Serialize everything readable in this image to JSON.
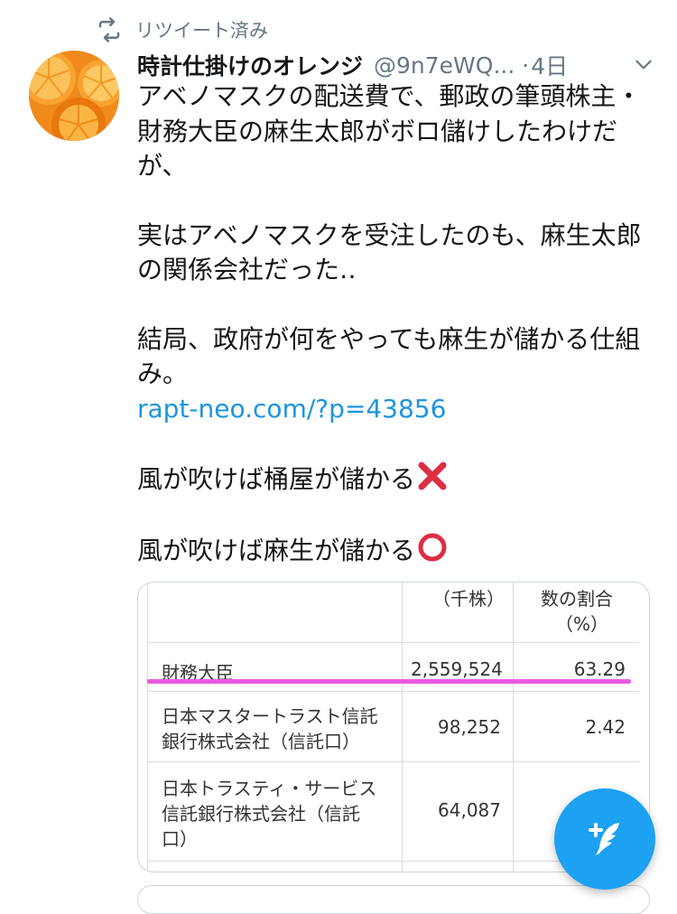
{
  "retweet": {
    "label": "リツイート済み"
  },
  "tweet": {
    "author_name": "時計仕掛けのオレンジ",
    "handle": "@9n7eWQ...",
    "dot": "·",
    "age": "4日",
    "lines": [
      "アベノマスクの配送費で、郵政の筆頭株主・",
      "財務大臣の麻生太郎がボロ儲けしたわけだ",
      "が、",
      "実はアベノマスクを受注したのも、麻生太郎",
      "の関係会社だった‥",
      "結局、政府が何をやっても麻生が儲かる仕組",
      "み。",
      "rapt-neo.com/?p=43856",
      "風が吹けば桶屋が儲かる",
      "風が吹けば麻生が儲かる"
    ]
  },
  "media_table": {
    "headers": [
      "（千株）",
      "数の割合",
      "（%）"
    ],
    "rows": [
      {
        "name_lines": [
          "財務大臣"
        ],
        "shares": "2,559,524",
        "pct": "63.29"
      },
      {
        "name_lines": [
          "日本マスタートラスト信託",
          "銀行株式会社（信託口）"
        ],
        "shares": "98,252",
        "pct": "2.42"
      },
      {
        "name_lines": [
          "日本トラスティ・サービス",
          "信託銀行株式会社（信託",
          "口）"
        ],
        "shares": "64,087",
        "pct": ""
      }
    ]
  },
  "colors": {
    "link": "#1b95e0",
    "secondary_text": "#657786",
    "fab": "#1da1f2",
    "highlight": "#e85be0",
    "card_border": "#ccd6dd"
  },
  "icons": {
    "retweet": "retweet-icon",
    "caret": "chevron-down-icon",
    "emoji_cross": "cross-mark-emoji",
    "emoji_circle": "hollow-red-circle-emoji",
    "compose": "compose-tweet-icon",
    "avatar": "orange-slices-avatar"
  }
}
